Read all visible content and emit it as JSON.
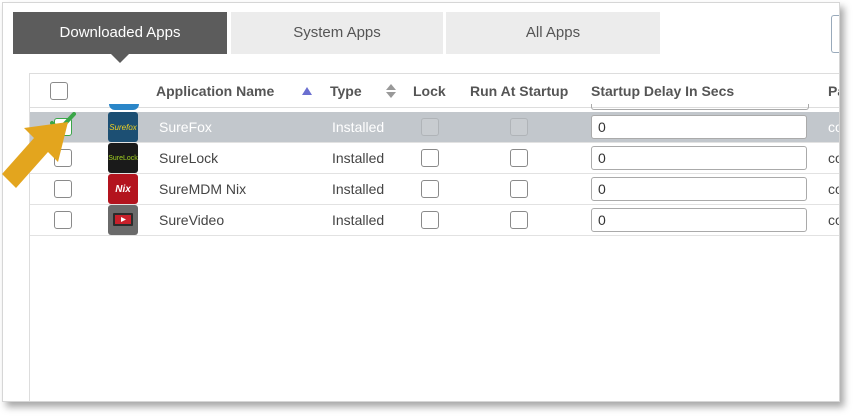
{
  "tabs": [
    {
      "label": "Downloaded Apps",
      "active": true
    },
    {
      "label": "System Apps",
      "active": false
    },
    {
      "label": "All Apps",
      "active": false
    }
  ],
  "table": {
    "headers": {
      "name": "Application Name",
      "type": "Type",
      "lock": "Lock",
      "startup": "Run At Startup",
      "delay": "Startup Delay In Secs",
      "partial": "Pa"
    },
    "rows": [
      {
        "name": "SureFox",
        "type": "Installed",
        "delay": "0",
        "partial": "co",
        "selected": true,
        "icon": "surefox-icon",
        "icon_text": "Surefox"
      },
      {
        "name": "SureLock",
        "type": "Installed",
        "delay": "0",
        "partial": "co",
        "selected": false,
        "icon": "surelock-icon",
        "icon_text": "SureLock"
      },
      {
        "name": "SureMDM Nix",
        "type": "Installed",
        "delay": "0",
        "partial": "co",
        "selected": false,
        "icon": "nix-icon",
        "icon_text": "Nix"
      },
      {
        "name": "SureVideo",
        "type": "Installed",
        "delay": "0",
        "partial": "co",
        "selected": false,
        "icon": "surevideo-icon",
        "icon_text": ""
      }
    ]
  },
  "colors": {
    "active_tab": "#5c5c5c",
    "inactive_tab": "#ececec",
    "selected_row": "#c2c7cc",
    "annotation_arrow": "#e3a51e",
    "checkmark": "#3aa648",
    "sort_active": "#6b6fd0"
  }
}
